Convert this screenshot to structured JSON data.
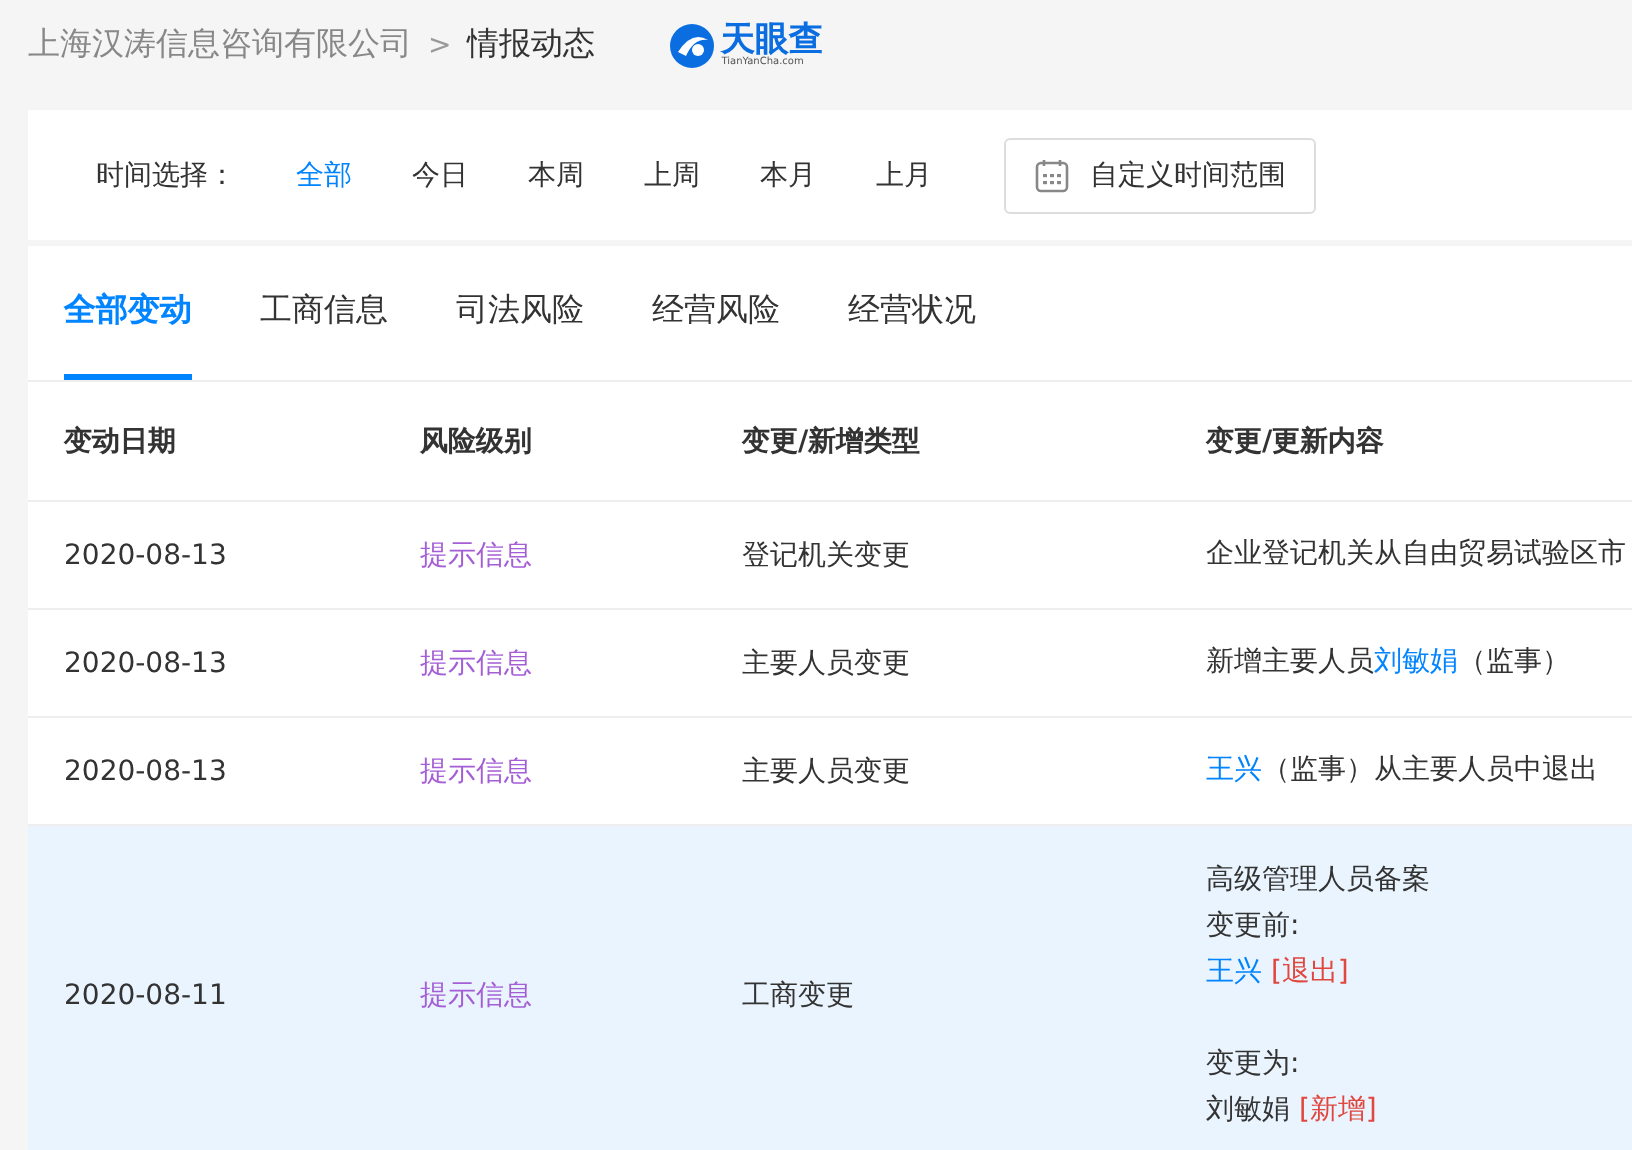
{
  "breadcrumb": {
    "company": "上海汉涛信息咨询有限公司",
    "separator": ">",
    "page": "情报动态"
  },
  "logo": {
    "name": "天眼查",
    "domain": "TianYanCha.com"
  },
  "time_filter": {
    "label": "时间选择：",
    "options": [
      {
        "label": "全部",
        "selected": true
      },
      {
        "label": "今日",
        "selected": false
      },
      {
        "label": "本周",
        "selected": false
      },
      {
        "label": "上周",
        "selected": false
      },
      {
        "label": "本月",
        "selected": false
      },
      {
        "label": "上月",
        "selected": false
      }
    ],
    "custom_range_button": "自定义时间范围"
  },
  "tabs": [
    {
      "label": "全部变动",
      "selected": true
    },
    {
      "label": "工商信息",
      "selected": false
    },
    {
      "label": "司法风险",
      "selected": false
    },
    {
      "label": "经营风险",
      "selected": false
    },
    {
      "label": "经营状况",
      "selected": false
    }
  ],
  "table": {
    "columns": [
      "变动日期",
      "风险级别",
      "变更/新增类型",
      "变更/更新内容"
    ],
    "rows": [
      {
        "date": "2020-08-13",
        "risk": "提示信息",
        "type": "登记机关变更",
        "selected": false,
        "content": [
          [
            {
              "kind": "text",
              "text": "企业登记机关从自由贸易试验区市"
            }
          ]
        ]
      },
      {
        "date": "2020-08-13",
        "risk": "提示信息",
        "type": "主要人员变更",
        "selected": false,
        "content": [
          [
            {
              "kind": "text",
              "text": "新增主要人员"
            },
            {
              "kind": "link",
              "text": "刘敏娟"
            },
            {
              "kind": "text",
              "text": "（监事）"
            }
          ]
        ]
      },
      {
        "date": "2020-08-13",
        "risk": "提示信息",
        "type": "主要人员变更",
        "selected": false,
        "content": [
          [
            {
              "kind": "link",
              "text": "王兴"
            },
            {
              "kind": "text",
              "text": "（监事）从主要人员中退出"
            }
          ]
        ]
      },
      {
        "date": "2020-08-11",
        "risk": "提示信息",
        "type": "工商变更",
        "selected": true,
        "content": [
          [
            {
              "kind": "text",
              "text": "高级管理人员备案"
            }
          ],
          [
            {
              "kind": "text",
              "text": "变更前:"
            }
          ],
          [
            {
              "kind": "link",
              "text": "王兴"
            },
            {
              "kind": "tag",
              "text": "[退出]"
            }
          ],
          [
            {
              "kind": "text",
              "text": "变更为:",
              "space_above": true
            }
          ],
          [
            {
              "kind": "text",
              "text": "刘敏娟"
            },
            {
              "kind": "tag",
              "text": "[新增]"
            }
          ]
        ]
      }
    ]
  }
}
